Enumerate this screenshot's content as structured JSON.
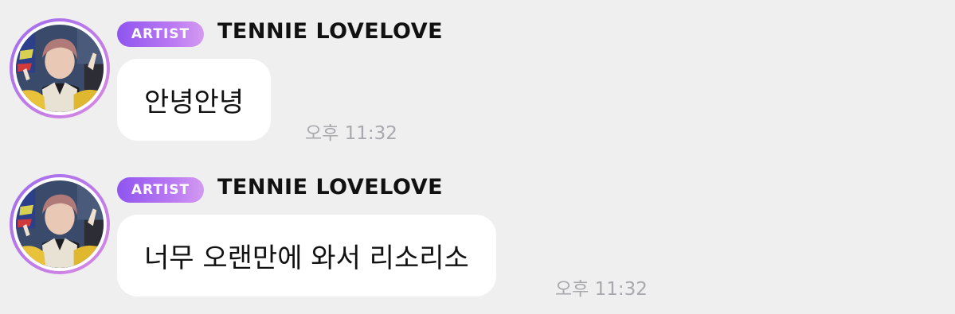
{
  "messages": [
    {
      "badge": "ARTIST",
      "sender": "TENNIE LOVELOVE",
      "text": "안녕안녕",
      "time": "오후 11:32"
    },
    {
      "badge": "ARTIST",
      "sender": "TENNIE LOVELOVE",
      "text": "너무 오랜만에 와서 리소리소",
      "time": "오후 11:32"
    }
  ],
  "colors": {
    "background": "#efeff0",
    "badge_gradient_start": "#8f55ef",
    "badge_gradient_end": "#d39af1",
    "bubble": "#ffffff",
    "timestamp": "#a9a9ad"
  }
}
